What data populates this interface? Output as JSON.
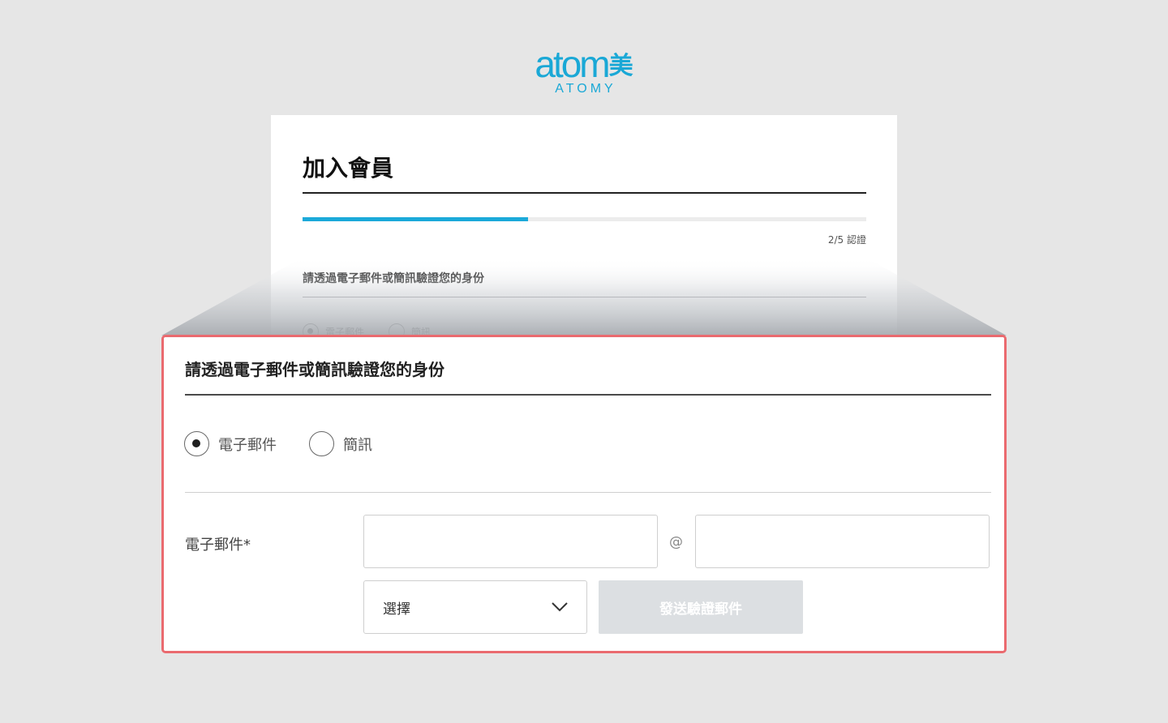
{
  "logo": {
    "word": "atom",
    "cjk": "美",
    "sub": "ATOMY"
  },
  "card": {
    "title": "加入會員",
    "progress_fraction": 0.4,
    "step_label": "2/5 認證",
    "instruction": "請透過電子郵件或簡訊驗證您的身份",
    "radio_options": [
      "電子郵件",
      "簡訊"
    ]
  },
  "zoom": {
    "instruction": "請透過電子郵件或簡訊驗證您的身份",
    "methods": {
      "email_label": "電子郵件",
      "sms_label": "簡訊",
      "selected": "email"
    },
    "email_field": {
      "label": "電子郵件*",
      "local_value": "",
      "at_sign": "@",
      "domain_value": ""
    },
    "domain_select": {
      "value": "選擇"
    },
    "send_button": "發送驗證郵件"
  },
  "colors": {
    "brand": "#1aa8d6",
    "highlight_border": "#ea6a6f",
    "disabled_button": "#dcdfe2"
  }
}
